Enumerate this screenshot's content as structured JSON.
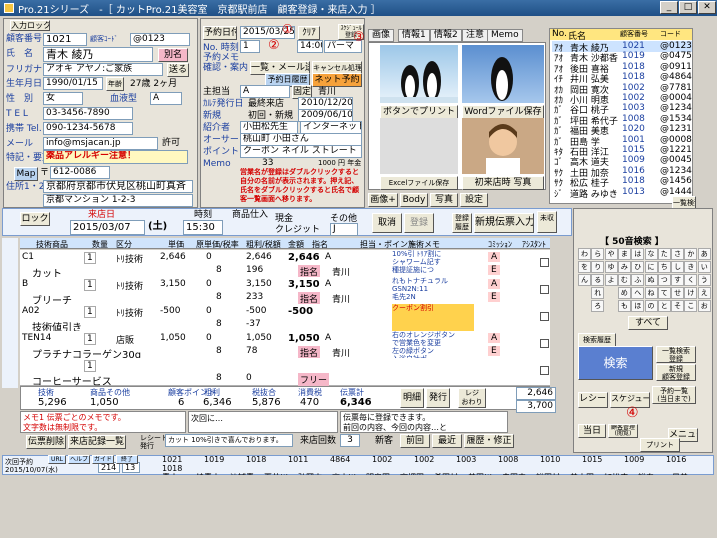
{
  "title": "Pro.21シリーズ　-［ カットPro.21美容室　京都駅前店　顧客登録・来店入力 ］",
  "win": {
    "min": "_",
    "max": "□",
    "close": "✕"
  },
  "customer": {
    "input_btn": "入力ロック",
    "no_label": "顧客番号",
    "no": "1021",
    "code_label": "顧客ｺｰﾄﾞ",
    "code": "@0123",
    "name_label": "氏　名",
    "name": "青木 綾乃",
    "kana_label": "フリガナ",
    "kana": "アオキ アヤノ:ご家族",
    "betsu": "別名",
    "shitei": "送る",
    "birth_label": "生年月日",
    "birth": "1990/01/15",
    "age": "27",
    "age_unit": "歳",
    "month": "2",
    "month_unit": "ヶ月",
    "jumin": "年齢",
    "sex_label": "性　別",
    "sex": "女",
    "blood_label": "血液型",
    "blood": "A",
    "tel_label": "T E L",
    "tel": "03-3456-7890",
    "mobile_label": "携帯 Tel.",
    "mobile": "090-1234-5678",
    "mail_label": "メール",
    "mail": "info@msjacan.jp",
    "allow": "許可",
    "note_label": "特記・要望",
    "note": "薬品アレルギー注意！",
    "zip_label": "〒",
    "zip": "612-0086",
    "map_btn": "Map",
    "addr_label": "住所1・2",
    "addr1": "京都府京都市伏見区桃山町真斉",
    "addr2": "京都マンション 1-2-3",
    "cat_label": "住所1・2"
  },
  "middle": {
    "appt_btn": "予約日付",
    "appt_date": "2015/03/25",
    "clear": "ｸﾘｱ",
    "schedule": "ｽｹｼﾞｭｰﾙ\n登録",
    "time_label": "No. 時刻",
    "time": "14:00",
    "menu": "パーマ",
    "yoyaku_memo": "予約メモ",
    "select": "1",
    "kakunin": "確認・案内",
    "ichiran": "一覧・メール送信",
    "cancel": "キャンセル処理",
    "yoyaku_hist": "予約日履歴",
    "net": "ネット予約",
    "tanto_label": "主担当",
    "tanto": "A",
    "kotei": "固定",
    "aoyama": "青川",
    "firstvisit_label": "ｶﾙﾃ発行日",
    "last_label": "最終来店",
    "last": "2010/12/20",
    "first_label": "新規",
    "first": "2009/06/10",
    "first_cb": "初回・新規",
    "intro_label": "紹介者",
    "intro": "小田松先生",
    "inner": "インターネット",
    "course_label": "オーサー",
    "points_label": "ポイント",
    "memo_label": "Memo",
    "town": "桃山町 小田さん",
    "coupon": "クーポン ネイル ストレート",
    "points": "33",
    "yen": "1000 円 年金",
    "warning": "営業名が登録はダブルクリックすると自分の名前が表示されます。押え記、氏名をダブルクリックすると氏名で顧客一覧画面へ移ります。"
  },
  "tabs": [
    "画像",
    "情報1",
    "情報2",
    "注意",
    "Memo"
  ],
  "photo": {
    "btn1": "ボタンでプリント",
    "btn2": "Wordファイル保存",
    "btn3": "Excelファイル保存",
    "btn4": "初来店時 写真"
  },
  "namelist": {
    "hdr": [
      "No.",
      "氏名",
      "顧客番号",
      "コード"
    ],
    "rows": [
      [
        "ｱｵ",
        "青木 綾乃",
        "1021",
        "@0123"
      ],
      [
        "ｱｵ",
        "青木 沙都香",
        "1019",
        "@0475"
      ],
      [
        "ｱｵ",
        "後田 喜裕",
        "1018",
        "@0911"
      ],
      [
        "ｲﾁ",
        "井川 弘美",
        "1018",
        "@4864"
      ],
      [
        "ｵｶ",
        "岡田 寛次",
        "1002",
        "@7781"
      ],
      [
        "ｵｶ",
        "小川 明恵",
        "1002",
        "@0004"
      ],
      [
        "ｶﾞ",
        "谷口 桃子",
        "1003",
        "@1234"
      ],
      [
        "ｶﾞ",
        "坪田 希代子",
        "1008",
        "@1534"
      ],
      [
        "ｶﾞ",
        "福田 美恵",
        "1020",
        "@1231"
      ],
      [
        "ｶﾞ",
        "田島 学",
        "1001",
        "@0008"
      ],
      [
        "ｷﾀ",
        "石田 洋江",
        "1015",
        "@1221"
      ],
      [
        "ｺﾞ",
        "高木 道夫",
        "1009",
        "@0045"
      ],
      [
        "ｻｸ",
        "土田 加奈",
        "1016",
        "@1234"
      ],
      [
        "ｻｸ",
        "松広 桂子",
        "1018",
        "@1456"
      ],
      [
        "ｼﾞ",
        "道路 みゆき",
        "1013",
        "@1444"
      ]
    ],
    "ichiran": "一覧検索へ"
  },
  "actions": {
    "gazou": "画像+",
    "body": "Body",
    "shuusei": "写真",
    "settei": "設定"
  },
  "visit": {
    "lock": "ロック",
    "date_label": "来店日",
    "date": "2015/03/07",
    "dow": "(土)",
    "time_label": "時刻",
    "time": "15:30",
    "shohin_label": "商品仕入",
    "genkin": "現金",
    "credit": "クレジット",
    "sonota": "その他",
    "J": "J",
    "cancel": "取消",
    "touroku": "登録",
    "update": "登録\n履歴",
    "new_btn": "新規伝票入力",
    "kessai": "未収"
  },
  "table_hdr": [
    "技術商品",
    "数量",
    "区分",
    "単価",
    "原単価/税率",
    "粗利/税額",
    "金額",
    "指名",
    "担当・ポイント",
    "施術メモ",
    "ｺﾐｯｼｮﾝ",
    "ｱｼｽﾀﾝﾄ"
  ],
  "lines": [
    {
      "code": "C1",
      "qty": "1",
      "kubun": "ﾄﾘ技術",
      "price": "2,646",
      "cost": "0",
      "gp": "2,646",
      "amount": "2,646",
      "shimei": "A",
      "tanto": "青川",
      "memo": "10%引 ﾄﾘｱ割に\nシャワーム記す\n種提証施につ",
      "name": "カット",
      "q2": "8",
      "tax": "196",
      "cat": "指名"
    },
    {
      "code": "B",
      "qty": "1",
      "kubun": "ﾄﾘ技術",
      "price": "3,150",
      "cost": "0",
      "gp": "3,150",
      "amount": "3,150",
      "shimei": "A",
      "tanto": "青川",
      "memo": "れもトナチュラル\nGSN2N:11\n毛先2N",
      "name": "ブリーチ",
      "q2": "8",
      "tax": "233",
      "cat": "指名"
    },
    {
      "code": "A02",
      "qty": "1",
      "kubun": "ﾄﾘ技術",
      "price": "-500",
      "cost": "0",
      "gp": "-500",
      "amount": "-500",
      "shimei": "",
      "tanto": "",
      "memo": "クーポン割引",
      "name": "技術値引き",
      "q2": "8",
      "tax": "-37",
      "cat": ""
    },
    {
      "code": "TEN14",
      "qty": "1",
      "kubun": "店販",
      "price": "1,050",
      "cost": "0",
      "gp": "1,050",
      "amount": "1,050",
      "shimei": "A",
      "tanto": "青川",
      "memo": "右のオレンジボタン\nで営業色を変更\n左の緑ボタン\n入浴自社ポ\nスタで変更可",
      "name": "プラチナコラーゲン30g",
      "q2": "8",
      "tax": "78",
      "cat": "指名"
    },
    {
      "code": "",
      "qty": "1",
      "kubun": "",
      "price": "",
      "cost": "",
      "gp": "",
      "amount": "",
      "shimei": "",
      "tanto": "",
      "memo": "",
      "name": "コーヒーサービス",
      "q2": "8",
      "tax": "0",
      "cat": "フリー"
    }
  ],
  "totals": {
    "hdr": [
      "技術",
      "商品その他",
      "顧客ポイント",
      "粗利",
      "税抜合",
      "消費税",
      "伝票計"
    ],
    "gijutsu": "5,296",
    "shohin": "1,050",
    "point": "6",
    "arari": "6,346",
    "zeinuki": "5,876",
    "tax": "470",
    "total": "6,346",
    "meisai": "明細",
    "hakkou": "発行",
    "tokuten": "レジ\nおわり",
    "r1": "2,646",
    "r2": "3,700",
    "memo1": "メモ1 伝票ごとのメモです。\n文字数は無制限です。",
    "memo2": "次回に…",
    "memo3": "伝票毎に登録できます。\n前回の内容、今回の内容…と",
    "denpyo_btn": "伝票削除",
    "kiroku_btn": "来店記録一覧",
    "receipt": "レシート\n発行",
    "discount": "カット 10%引きで喜んでおります。",
    "count_label": "来店回数",
    "count": "3",
    "shinki": "新客",
    "prev": "前回",
    "saikin": "最近",
    "rireki": "履歴・修正"
  },
  "right": {
    "search_hdr": "【 50音検索 】",
    "all": "すべて",
    "kensaku": "検索",
    "kensaku_btn": "検索履歴",
    "ichiran_btn": "一覧検索\n登録",
    "shinki_btn": "新規\n顧客登録",
    "receipt": "レシート",
    "schedule": "スケジュール",
    "jitai": "当日",
    "gazou": "写真",
    "yoyaku": "予約一覧\n(当日まで)",
    "kanri": "管理",
    "menu": "メニュー",
    "hyou": "顧客管理\n(閲覧)",
    "print": "プリント",
    "marker2": "②",
    "marker3": "③",
    "marker4": "④"
  },
  "bottom": {
    "jisseki": "次回予約",
    "jisseki_date": "2015/10/07(水)",
    "num1": "214",
    "num2": "13",
    "buttons": [
      "URL",
      "ヘルプ",
      "ガイド",
      "終了"
    ],
    "ticker_nums": [
      "1021",
      "1019",
      "1018",
      "1011",
      "4864",
      "1002",
      "1002",
      "1003",
      "1008",
      "1010",
      "1015",
      "1009",
      "1016",
      "1018"
    ],
    "ticker_names": [
      "青木",
      "綾青木",
      "沙誠青",
      "夏井川",
      "弘岡本",
      "高小川",
      "明奥田",
      "寛押田",
      "希田村",
      "美田川",
      "寺田中",
      "裕田村",
      "美土田",
      "加松広",
      "裕春",
      "景美"
    ]
  }
}
